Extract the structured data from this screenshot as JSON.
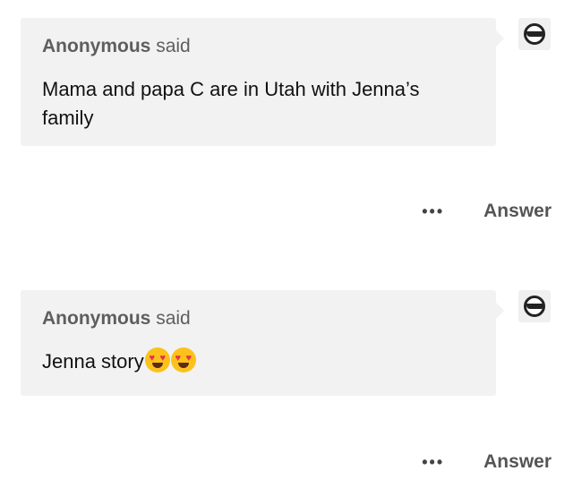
{
  "posts": [
    {
      "asker_name": "Anonymous",
      "asker_suffix": "said",
      "question": "Mama and papa C are in Utah with Jenna’s family",
      "more_icon": "more-options-icon",
      "answer_label": "Answer"
    },
    {
      "asker_name": "Anonymous",
      "asker_suffix": "said",
      "question": "Jenna story",
      "emojis": [
        "heart-eyes-emoji",
        "heart-eyes-emoji"
      ],
      "more_icon": "more-options-icon",
      "answer_label": "Answer"
    }
  ],
  "colors": {
    "bubble": "#f2f2f2",
    "muted_text": "#5e5e5e",
    "answer_text": "#555555"
  }
}
